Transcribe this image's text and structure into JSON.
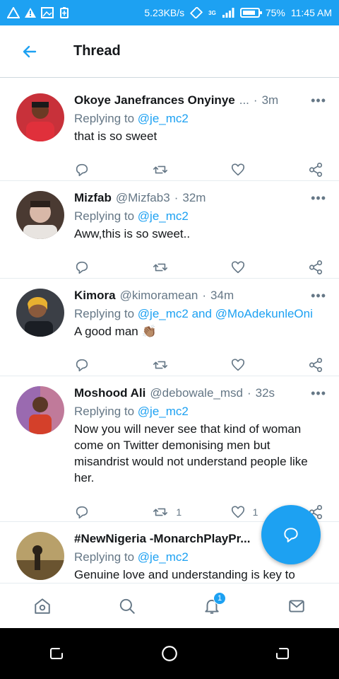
{
  "status_bar": {
    "speed": "5.23KB/s",
    "network": "3G",
    "battery": "75%",
    "time": "11:45 AM"
  },
  "header": {
    "title": "Thread"
  },
  "tweets": [
    {
      "name": "Okoye Janefrances Onyinye",
      "ellipsis": "...",
      "handle": "",
      "time": "3m",
      "reply_prefix": "Replying to",
      "reply_to": "@je_mc2",
      "text": "that is so sweet",
      "retweets": "",
      "likes": ""
    },
    {
      "name": "Mizfab",
      "handle": "@Mizfab3",
      "time": "32m",
      "reply_prefix": "Replying to",
      "reply_to": "@je_mc2",
      "text": "Aww,this is so sweet..",
      "retweets": "",
      "likes": ""
    },
    {
      "name": "Kimora",
      "handle": "@kimoramean",
      "time": "34m",
      "reply_prefix": "Replying to",
      "reply_to": "@je_mc2 and @MoAdekunleOni",
      "text": "A good man",
      "emoji": "👏🏽",
      "retweets": "",
      "likes": ""
    },
    {
      "name": "Moshood Ali",
      "handle": "@debowale_msd",
      "time": "32s",
      "reply_prefix": "Replying to",
      "reply_to": "@je_mc2",
      "text": "Now you will never see that kind of woman come on Twitter demonising men but misandrist would not understand people like her.",
      "retweets": "1",
      "likes": "1"
    },
    {
      "name": "#NewNigeria -MonarchPlayPr...",
      "handle": "",
      "time": "",
      "reply_prefix": "Replying to",
      "reply_to": "@je_mc2",
      "text": "Genuine love and understanding is key to",
      "retweets": "",
      "likes": ""
    }
  ],
  "bottom_nav": {
    "notification_count": "1"
  },
  "colors": {
    "accent": "#1da1f2",
    "secondary_text": "#657786",
    "primary_text": "#14171a"
  }
}
